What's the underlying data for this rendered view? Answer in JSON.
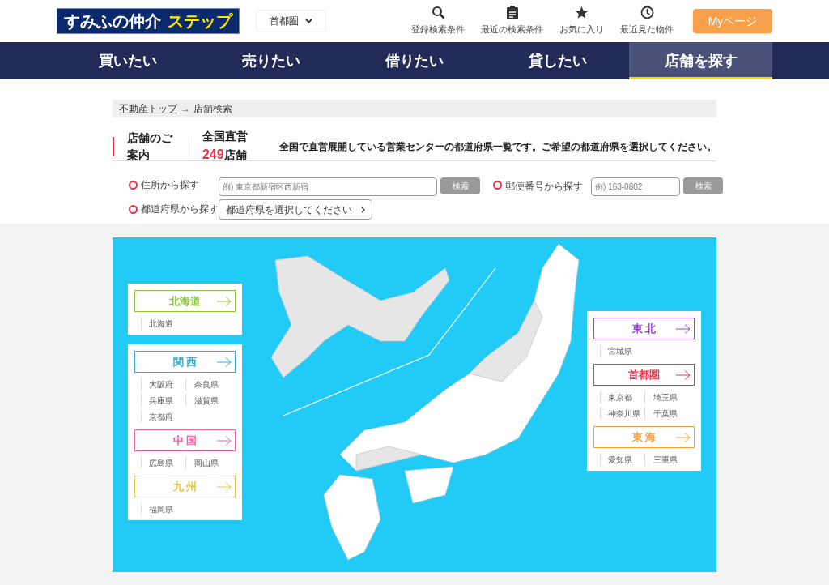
{
  "logo": {
    "main": "すみふの仲介",
    "accent": "ステップ"
  },
  "area_select": {
    "value": "首都圏"
  },
  "header_links": [
    {
      "label": "登録検索条件"
    },
    {
      "label": "最近の検索条件"
    },
    {
      "label": "お気に入り"
    },
    {
      "label": "最近見た物件"
    }
  ],
  "mypage_button": "Myページ",
  "nav": [
    {
      "label": "買いたい",
      "selected": false
    },
    {
      "label": "売りたい",
      "selected": false
    },
    {
      "label": "借りたい",
      "selected": false
    },
    {
      "label": "貸したい",
      "selected": false
    },
    {
      "label": "店舗を探す",
      "selected": true
    }
  ],
  "breadcrumb": [
    {
      "label": "不動産トップ",
      "kind": "link"
    },
    {
      "label": "→",
      "kind": "separator"
    },
    {
      "label": "店舗検索",
      "kind": "current"
    }
  ],
  "heading": {
    "title": "店舗のご案内",
    "count": "全国直営**249**店舗",
    "description": "全国で直営展開している営業センターの都道府県一覧です。ご希望の都道府県を選択してください。"
  },
  "search": {
    "address": {
      "label": "住所から探す",
      "placeholder": "例) 東京都新宿区西新宿",
      "button": "検索"
    },
    "prefecture": {
      "label": "都道府県から探す",
      "button": "都道府県を選択してください"
    },
    "postal": {
      "label": "郵便番号から探す",
      "placeholder": "例) 163-0802",
      "button": "検索"
    }
  },
  "map": {
    "left_panels": [
      {
        "regions": [
          {
            "name": "北海道",
            "color": "#8cc63f",
            "prefectures": [
              "北海道"
            ]
          }
        ]
      },
      {
        "regions": [
          {
            "name": "関 西",
            "color": "#29abe2",
            "prefectures": [
              "大阪府",
              "奈良県",
              "兵庫県",
              "滋賀県",
              "京都府"
            ]
          },
          {
            "name": "中 国",
            "color": "#f0609e",
            "prefectures": [
              "広島県",
              "岡山県"
            ]
          },
          {
            "name": "九 州",
            "color": "#e6c440",
            "prefectures": [
              "福岡県"
            ]
          }
        ]
      }
    ],
    "right_panels": [
      {
        "regions": [
          {
            "name": "東 北",
            "color": "#9b3fd1",
            "prefectures": [
              "宮城県"
            ]
          },
          {
            "name": "首都圏",
            "color": "#e8334a",
            "prefectures": [
              "東京都",
              "埼玉県",
              "神奈川県",
              "千葉県"
            ]
          },
          {
            "name": "東 海",
            "color": "#f7a03c",
            "prefectures": [
              "愛知県",
              "三重県"
            ]
          }
        ]
      }
    ]
  }
}
